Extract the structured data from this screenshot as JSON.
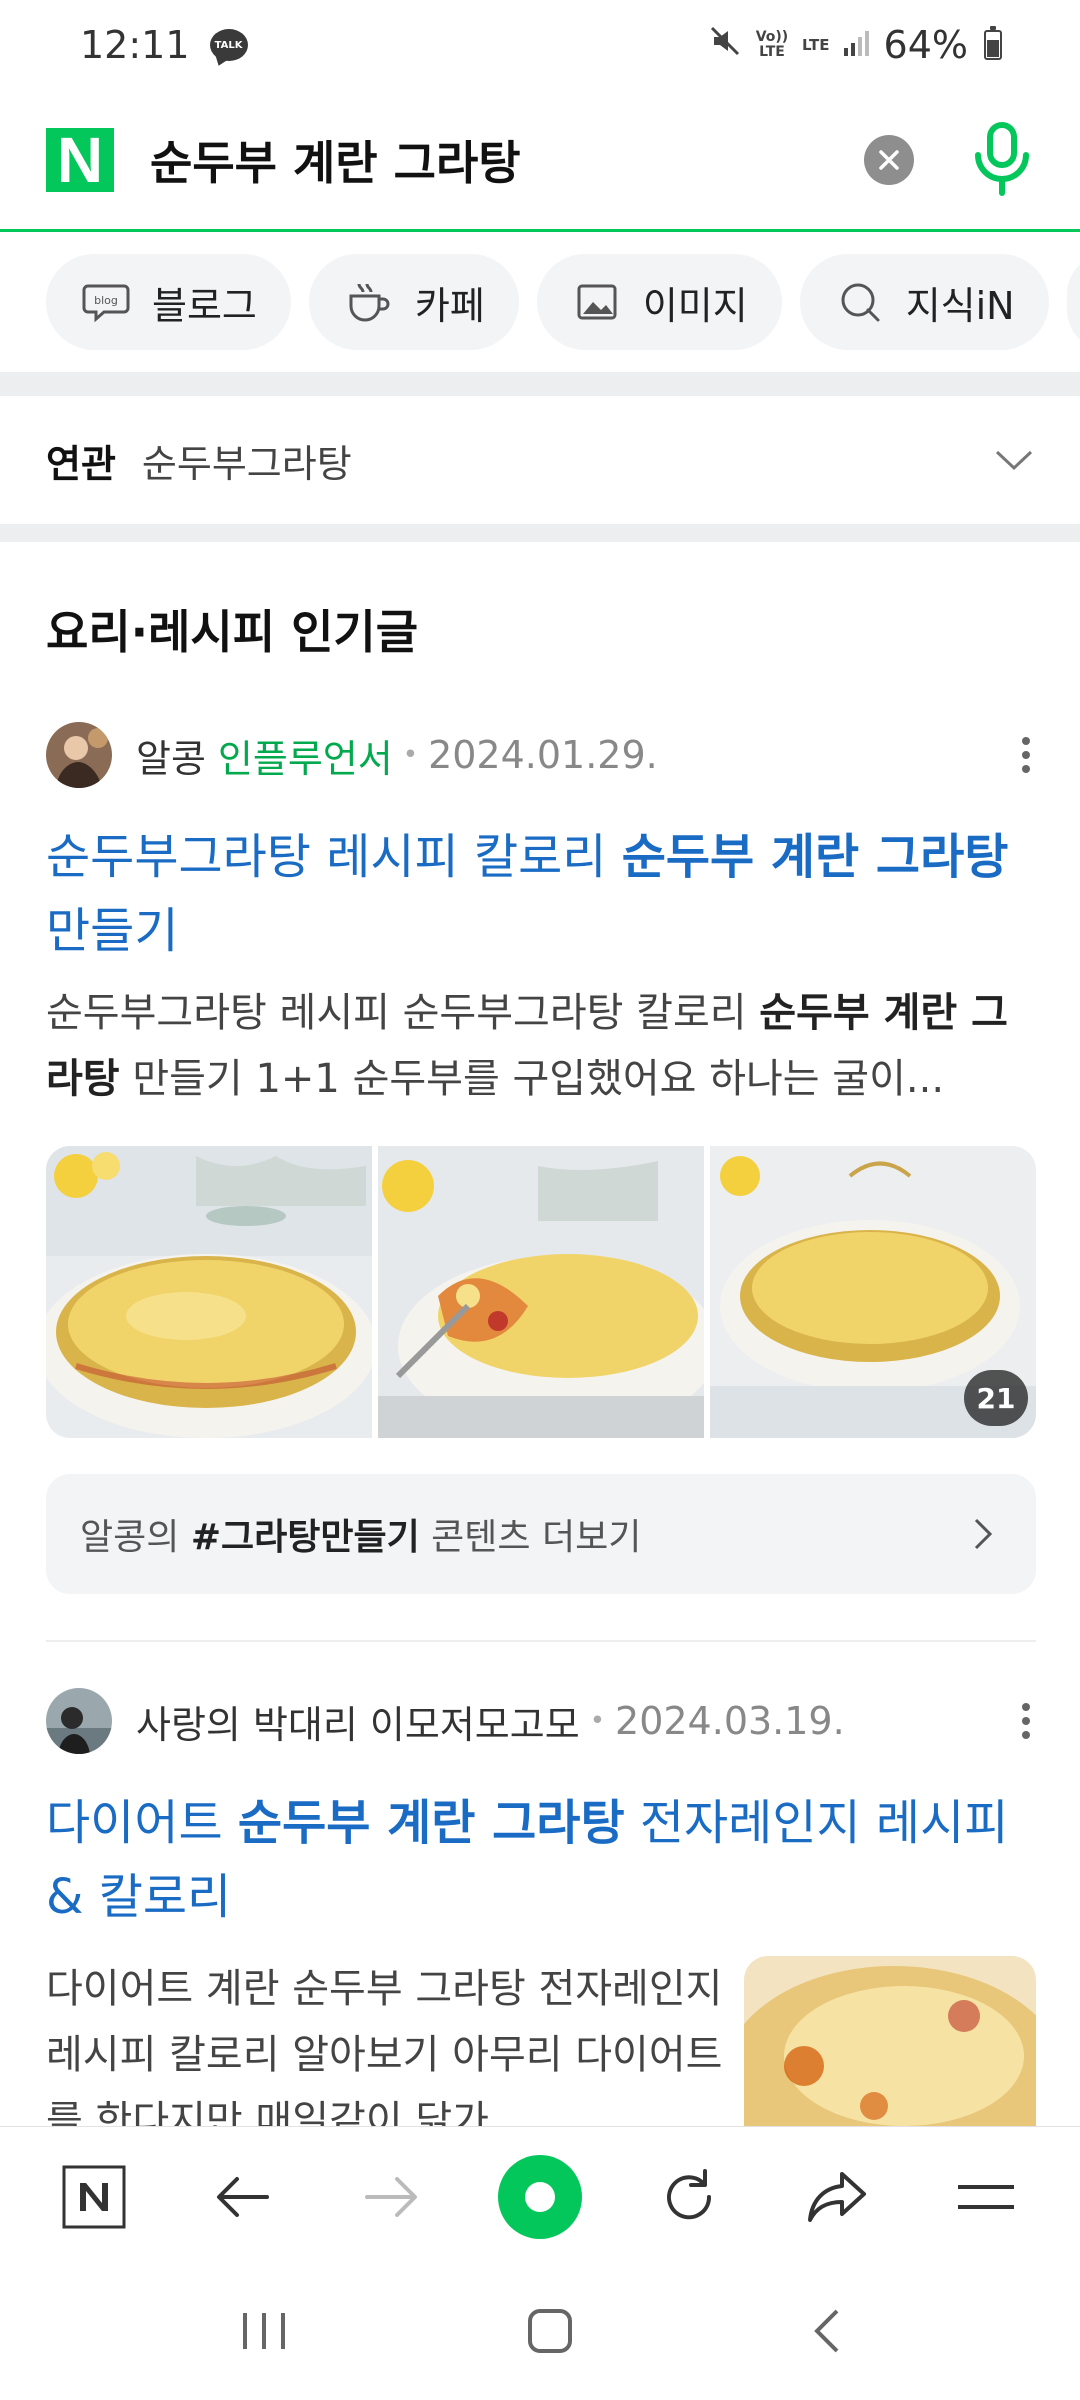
{
  "status_bar": {
    "time": "12:11",
    "talk_label": "TALK",
    "volte": "Vo)) LTE",
    "lte": "LTE",
    "battery": "64%",
    "battery_level": 0.64
  },
  "search": {
    "query": "순두부 계란 그라탕",
    "logo": "N"
  },
  "tabs": [
    {
      "label": "블로그",
      "icon": "blog-icon"
    },
    {
      "label": "카페",
      "icon": "cafe-icon"
    },
    {
      "label": "이미지",
      "icon": "image-icon"
    },
    {
      "label": "지식iN",
      "icon": "knowledge-icon"
    }
  ],
  "related": {
    "label": "연관",
    "value": "순두부그라탕"
  },
  "section": {
    "title": "요리·레시피 인기글"
  },
  "posts": [
    {
      "author": "알콩",
      "badge": "인플루언서",
      "date": "2024.01.29.",
      "title_pre": "순두부그라탕 레시피 칼로리 ",
      "title_bold": "순두부 계란 그라탕",
      "title_post": " 만들기",
      "snippet_pre": "순두부그라탕 레시피 순두부그라탕 칼로리 ",
      "snippet_bold": "순두부 계란 그라탕",
      "snippet_post": " 만들기 1+1 순두부를 구입했어요 하나는 굴이...",
      "image_count": "21",
      "more_pre": "알콩의 ",
      "more_tag": "#그라탕만들기",
      "more_post": " 콘텐츠 더보기"
    },
    {
      "author": "사랑의 박대리 이모저모고모",
      "date": "2024.03.19.",
      "title_pre": "다이어트 ",
      "title_bold": "순두부 계란 그라탕",
      "title_post": " 전자레인지 레시피 & 칼로리",
      "snippet": "다이어트 계란 순두부 그라탕 전자레인지 레시피 칼로리 알아보기 아무리 다이어트를 한다지만 매일같이 닭가"
    }
  ],
  "colors": {
    "naver_green": "#03c75a",
    "link_blue": "#1a6bc4"
  }
}
